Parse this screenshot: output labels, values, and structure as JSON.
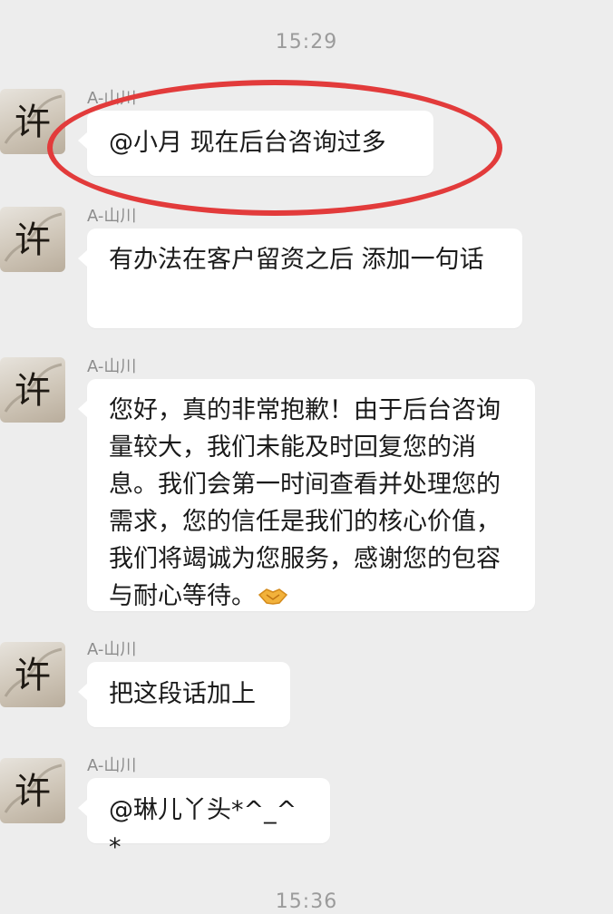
{
  "timestamps": {
    "top": "15:29",
    "bottom": "15:36"
  },
  "avatar_glyph": "许",
  "messages": [
    {
      "sender": "A-山川",
      "text": "@小月 现在后台咨询过多"
    },
    {
      "sender": "A-山川",
      "text": "有办法在客户留资之后 添加一句话"
    },
    {
      "sender": "A-山川",
      "text": "您好，真的非常抱歉！由于后台咨询量较大，我们未能及时回复您的消息。我们会第一时间查看并处理您的需求，您的信任是我们的核心价值，我们将竭诚为您服务，感谢您的包容与耐心等待。",
      "emoji": "handshake-icon"
    },
    {
      "sender": "A-山川",
      "text": "把这段话加上"
    },
    {
      "sender": "A-山川",
      "text": "@琳儿丫头*^_^*"
    }
  ],
  "colors": {
    "background": "#ededed",
    "bubble": "#ffffff",
    "highlight": "#e23b3b"
  }
}
